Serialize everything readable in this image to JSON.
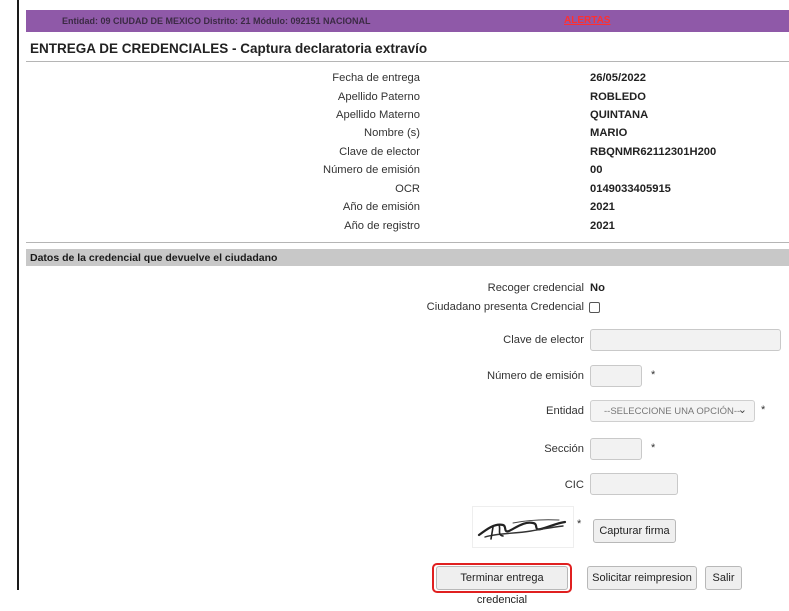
{
  "header": {
    "entidad_text": "Entidad: 09 CIUDAD DE MEXICO Distrito: 21 Módulo: 092151 NACIONAL",
    "alertas_link": "ALERTAS",
    "bar_color": "#8f59a8"
  },
  "page_title": "ENTREGA DE CREDENCIALES - Captura declaratoria extravío",
  "info": {
    "rows": [
      {
        "label": "Fecha de entrega",
        "value": "26/05/2022"
      },
      {
        "label": "Apellido Paterno",
        "value": "ROBLEDO"
      },
      {
        "label": "Apellido Materno",
        "value": "QUINTANA"
      },
      {
        "label": "Nombre (s)",
        "value": "MARIO"
      },
      {
        "label": "Clave de elector",
        "value": "RBQNMR62112301H200"
      },
      {
        "label": "Número de emisión",
        "value": "00"
      },
      {
        "label": "OCR",
        "value": "0149033405915"
      },
      {
        "label": "Año de emisión",
        "value": "2021"
      },
      {
        "label": "Año de registro",
        "value": "2021"
      }
    ]
  },
  "section": {
    "title": "Datos de la credencial que devuelve el ciudadano"
  },
  "form": {
    "recoger_label": "Recoger credencial",
    "recoger_value": "No",
    "presenta_label": "Ciudadano presenta Credencial",
    "presenta_checked": false,
    "clave_label": "Clave de elector",
    "clave_value": "",
    "emision_label": "Número de emisión",
    "emision_value": "",
    "entidad_label": "Entidad",
    "entidad_selected": "--SELECCIONE UNA OPCIÓN--",
    "seccion_label": "Sección",
    "seccion_value": "",
    "cic_label": "CIC",
    "cic_value": "",
    "required_mark": "*"
  },
  "buttons": {
    "capturar_firma": "Capturar firma",
    "terminar": "Terminar entrega credencial",
    "solicitar": "Solicitar reimpresion",
    "salir": "Salir"
  },
  "highlight_color": "#e02020"
}
